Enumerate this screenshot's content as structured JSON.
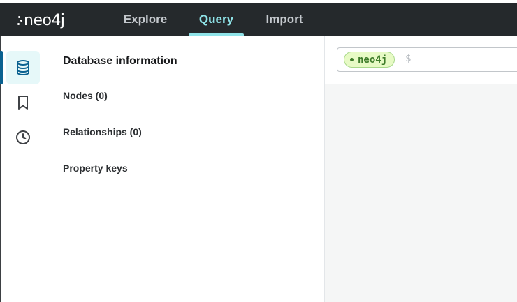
{
  "app": {
    "logo_text": "neo4j"
  },
  "nav": {
    "tabs": [
      {
        "label": "Explore",
        "active": false
      },
      {
        "label": "Query",
        "active": true
      },
      {
        "label": "Import",
        "active": false
      }
    ]
  },
  "rail": {
    "items": [
      {
        "icon": "database-icon",
        "active": true
      },
      {
        "icon": "bookmark-icon",
        "active": false
      },
      {
        "icon": "history-icon",
        "active": false
      }
    ]
  },
  "panel": {
    "title": "Database information",
    "nodes": "Nodes (0)",
    "relationships": "Relationships (0)",
    "property_keys": "Property keys"
  },
  "editor": {
    "database": "neo4j",
    "prompt": "$"
  },
  "colors": {
    "topbar": "#25292c",
    "accent": "#8fe3e8",
    "pill_bg": "#e7fac5",
    "pill_text": "#3e7c2a",
    "rail_active": "#e6f8f9",
    "rail_indicator": "#0a6190"
  }
}
